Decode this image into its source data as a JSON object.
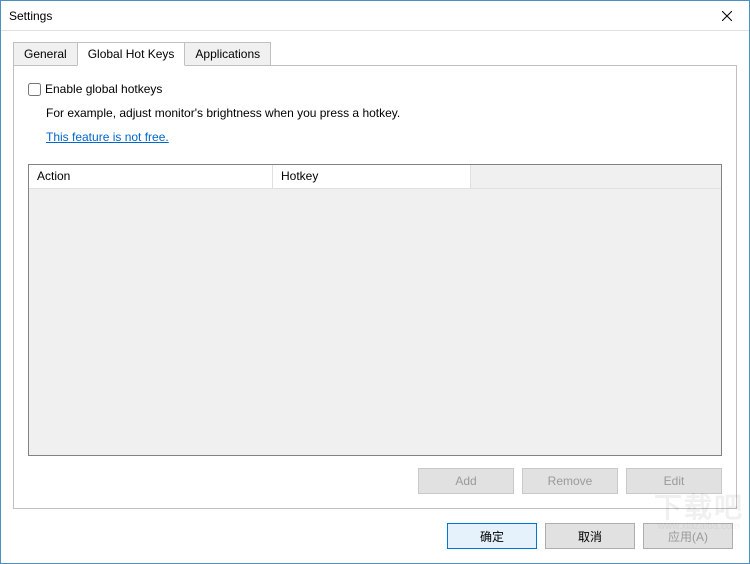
{
  "window": {
    "title": "Settings"
  },
  "tabs": [
    {
      "label": "General",
      "active": false
    },
    {
      "label": "Global Hot Keys",
      "active": true
    },
    {
      "label": "Applications",
      "active": false
    }
  ],
  "panel": {
    "enable_checkbox_label": "Enable global hotkeys",
    "enable_checked": false,
    "description": "For example, adjust monitor's brightness when you press a hotkey.",
    "not_free_link": "This feature is not free."
  },
  "table": {
    "columns": {
      "action": "Action",
      "hotkey": "Hotkey"
    },
    "rows": []
  },
  "buttons": {
    "add": "Add",
    "remove": "Remove",
    "edit": "Edit"
  },
  "dialog": {
    "ok": "确定",
    "cancel": "取消",
    "apply": "应用(A)"
  },
  "watermark": {
    "main": "下载吧",
    "sub": "www.xiazaiba.com"
  }
}
